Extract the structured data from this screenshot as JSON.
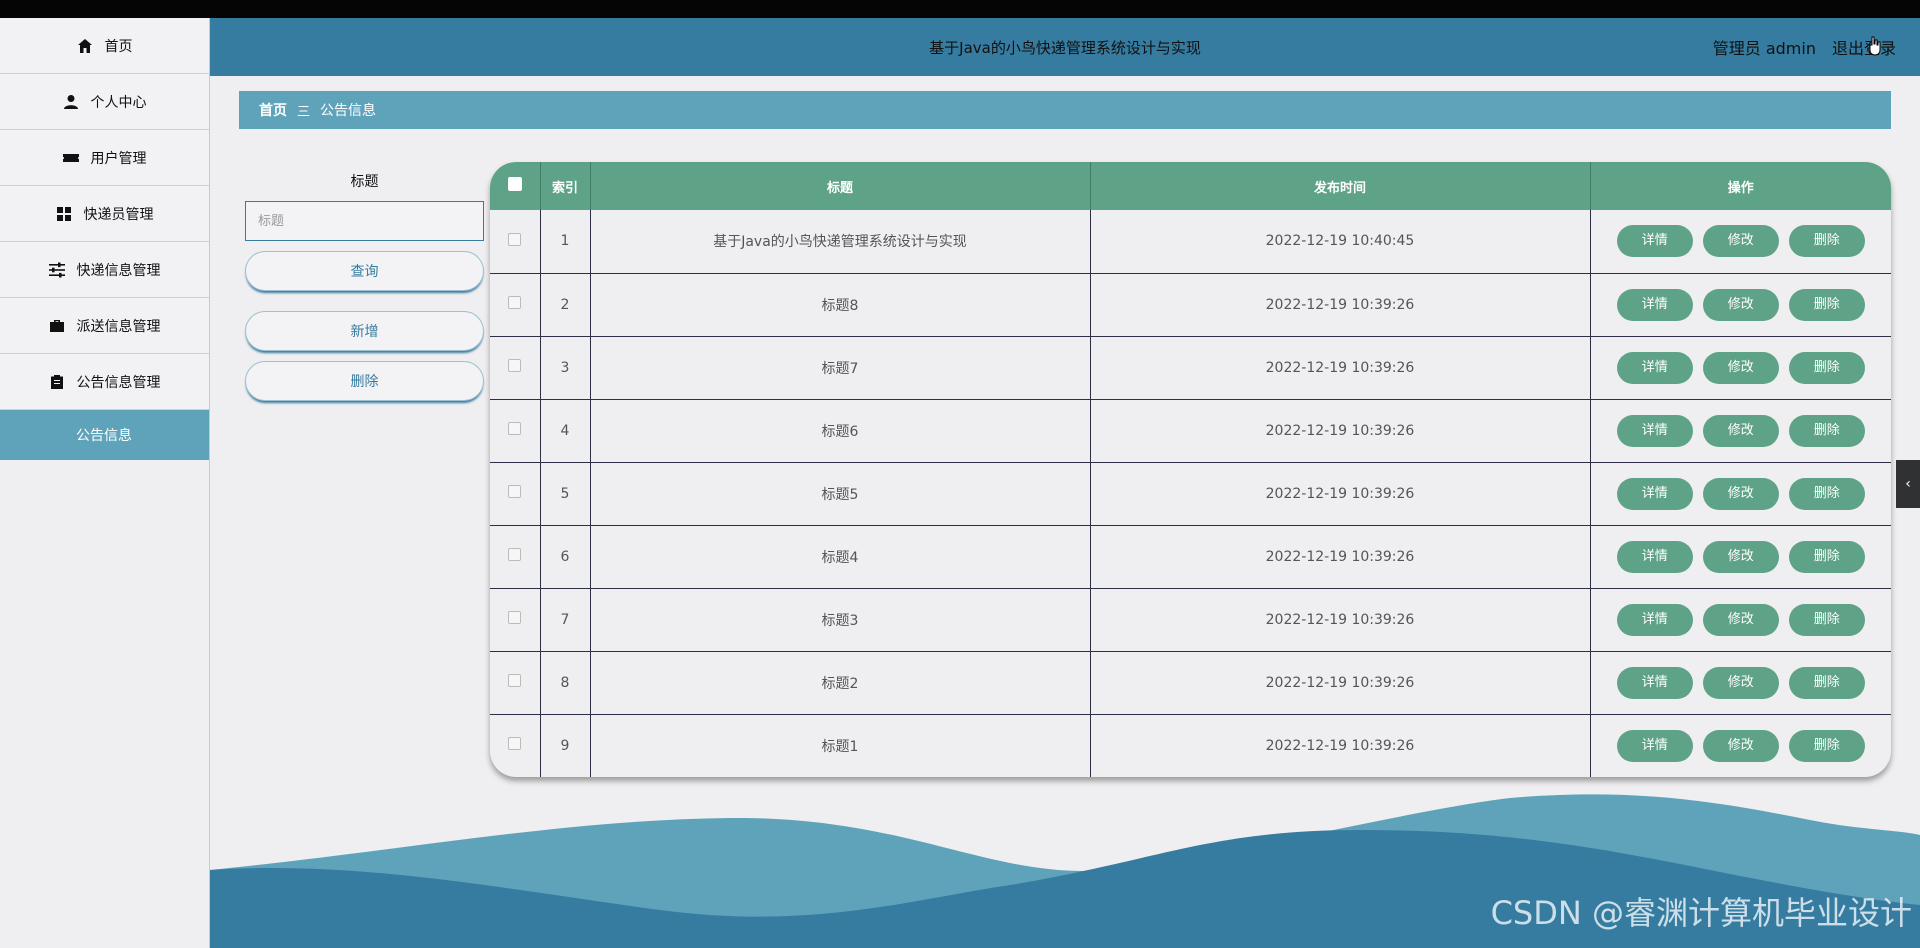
{
  "header": {
    "title": "基于Java的小鸟快递管理系统设计与实现",
    "user_label": "管理员 admin",
    "logout_label": "退出登录"
  },
  "sidebar": {
    "items": [
      {
        "label": "首页",
        "icon": "home-icon"
      },
      {
        "label": "个人中心",
        "icon": "user-icon"
      },
      {
        "label": "用户管理",
        "icon": "ticket-icon"
      },
      {
        "label": "快递员管理",
        "icon": "grid-icon"
      },
      {
        "label": "快递信息管理",
        "icon": "sliders-icon"
      },
      {
        "label": "派送信息管理",
        "icon": "briefcase-icon"
      },
      {
        "label": "公告信息管理",
        "icon": "clipboard-icon"
      }
    ],
    "active_sub": "公告信息"
  },
  "breadcrumb": {
    "home": "首页",
    "separator": "三",
    "current": "公告信息"
  },
  "search": {
    "label": "标题",
    "placeholder": "标题",
    "query_button": "查询",
    "add_button": "新增",
    "delete_button": "删除"
  },
  "table": {
    "headers": [
      "索引",
      "标题",
      "发布时间",
      "操作"
    ],
    "actions": [
      "详情",
      "修改",
      "删除"
    ],
    "rows": [
      {
        "index": "1",
        "title": "基于Java的小鸟快递管理系统设计与实现",
        "time": "2022-12-19 10:40:45"
      },
      {
        "index": "2",
        "title": "标题8",
        "time": "2022-12-19 10:39:26"
      },
      {
        "index": "3",
        "title": "标题7",
        "time": "2022-12-19 10:39:26"
      },
      {
        "index": "4",
        "title": "标题6",
        "time": "2022-12-19 10:39:26"
      },
      {
        "index": "5",
        "title": "标题5",
        "time": "2022-12-19 10:39:26"
      },
      {
        "index": "6",
        "title": "标题4",
        "time": "2022-12-19 10:39:26"
      },
      {
        "index": "7",
        "title": "标题3",
        "time": "2022-12-19 10:39:26"
      },
      {
        "index": "8",
        "title": "标题2",
        "time": "2022-12-19 10:39:26"
      },
      {
        "index": "9",
        "title": "标题1",
        "time": "2022-12-19 10:39:26"
      }
    ]
  },
  "watermark": "CSDN @睿渊计算机毕业设计",
  "colors": {
    "header": "#357ca0",
    "accent": "#5fa3bb",
    "table_head": "#5ea387",
    "action_button": "#5ea387"
  }
}
